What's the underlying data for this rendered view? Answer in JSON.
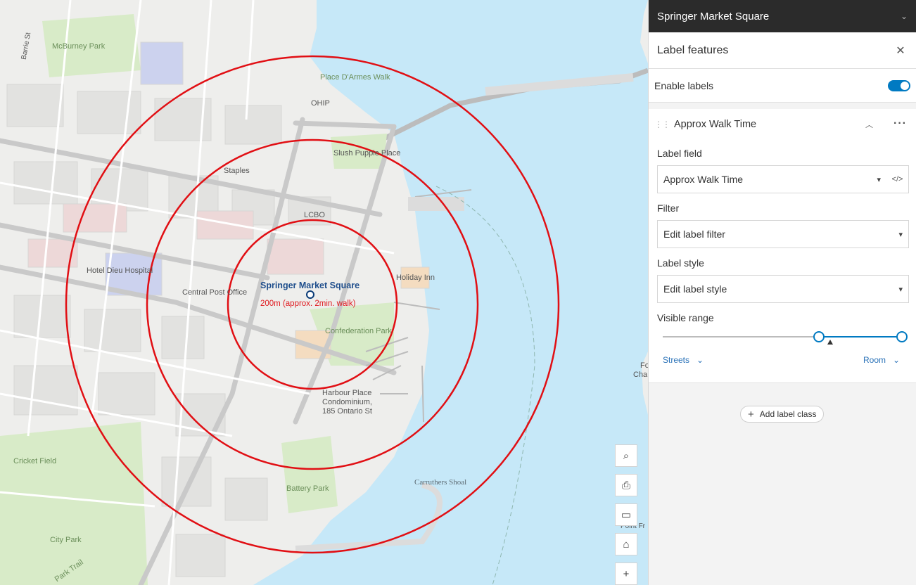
{
  "map": {
    "labels": {
      "mcburney_park": "McBurney Park",
      "barrie_st": "Barrie St",
      "place_darmes": "Place D'Armes Walk",
      "ohip": "OHIP",
      "slush_puppie": "Slush Puppie Place",
      "staples": "Staples",
      "lcbo": "LCBO",
      "hotel_dieu": "Hotel Dieu Hospital",
      "central_post": "Central Post Office",
      "holiday_inn": "Holiday Inn",
      "confederation_park": "Confederation Park",
      "harbour_place": "Harbour Place",
      "condominium": "Condominium,",
      "ontario_st": "185 Ontario St",
      "carruthers_shoal": "Carruthers Shoal",
      "cricket_field": "Cricket Field",
      "battery_park": "Battery Park",
      "city_park": "City Park",
      "park_trail": "Park Trail",
      "edge_fo": "Fo",
      "edge_cha": "Cha",
      "edge_point": "Point Fr"
    },
    "feature": {
      "title": "Springer Market Square",
      "sublabel": "200m (approx. 2min. walk)"
    },
    "colors": {
      "ring": "#e10f14",
      "water": "#c6e8f8",
      "road": "#c9c9c9"
    },
    "tools": [
      "search-icon",
      "print-icon",
      "display-icon",
      "home-icon",
      "zoom-in-icon"
    ]
  },
  "panel": {
    "layer_title": "Springer Market Square",
    "label_features_title": "Label features",
    "enable_labels": "Enable labels",
    "enable_labels_on": true,
    "label_class": {
      "name": "Approx Walk Time",
      "label_field_label": "Label field",
      "label_field_value": "Approx Walk Time",
      "filter_label": "Filter",
      "filter_value": "Edit label filter",
      "style_label": "Label style",
      "style_value": "Edit label style",
      "visible_range_label": "Visible range",
      "range_min": "Streets",
      "range_max": "Room"
    },
    "add_label_class": "Add label class"
  }
}
